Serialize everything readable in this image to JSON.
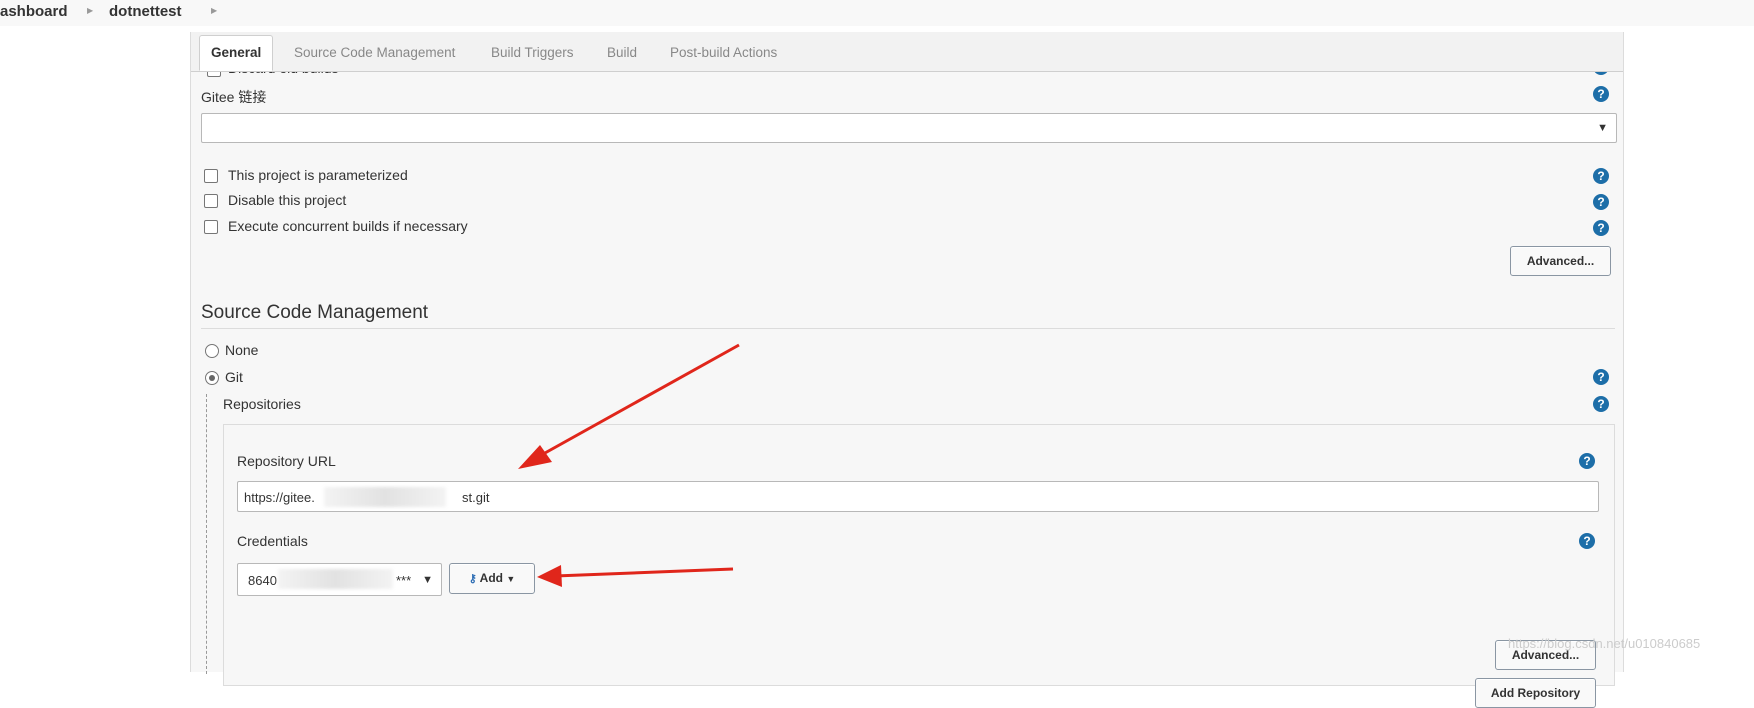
{
  "breadcrumb": {
    "items": [
      "ashboard",
      "dotnettest"
    ]
  },
  "tabs": [
    {
      "label": "General",
      "active": true
    },
    {
      "label": "Source Code Management",
      "active": false
    },
    {
      "label": "Build Triggers",
      "active": false
    },
    {
      "label": "Build",
      "active": false
    },
    {
      "label": "Post-build Actions",
      "active": false
    }
  ],
  "general": {
    "partial_label": "Discard old builds",
    "gitee_label": "Gitee 链接",
    "gitee_value": "",
    "options": [
      {
        "label": "This project is parameterized",
        "checked": false
      },
      {
        "label": "Disable this project",
        "checked": false
      },
      {
        "label": "Execute concurrent builds if necessary",
        "checked": false
      }
    ],
    "advanced_label": "Advanced..."
  },
  "scm": {
    "heading": "Source Code Management",
    "choices": [
      {
        "label": "None",
        "selected": false
      },
      {
        "label": "Git",
        "selected": true
      }
    ],
    "repositories_label": "Repositories",
    "repo_url_label": "Repository URL",
    "repo_url_prefix": "https://gitee.",
    "repo_url_suffix": "st.git",
    "credentials_label": "Credentials",
    "credentials_prefix": "8640",
    "credentials_suffix": "***",
    "add_label": "Add",
    "advanced_label": "Advanced...",
    "add_repository_label": "Add Repository"
  },
  "help_icon": "?",
  "watermark": "https://blog.csdn.net/u010840685",
  "colors": {
    "help": "#1d6ea8",
    "arrow": "#e0261b"
  }
}
